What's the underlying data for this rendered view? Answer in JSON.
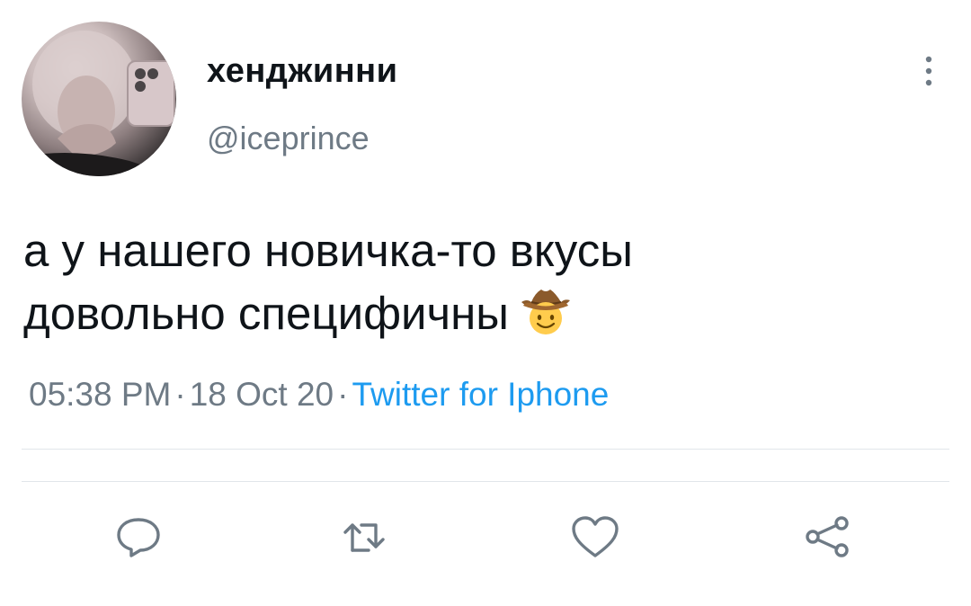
{
  "author": {
    "display_name": "хенджинни",
    "handle": "@iceprince"
  },
  "tweet": {
    "text_line1": "а у нашего новичка-то вкусы",
    "text_line2": "довольно специфичны",
    "emoji": "cowboy-hat-face"
  },
  "meta": {
    "time": "05:38 PM",
    "separator": "·",
    "date": "18 Oct 20",
    "source": "Twitter for Iphone"
  },
  "actions": [
    {
      "name": "reply",
      "icon": "reply-icon"
    },
    {
      "name": "retweet",
      "icon": "retweet-icon"
    },
    {
      "name": "like",
      "icon": "heart-icon"
    },
    {
      "name": "share",
      "icon": "share-icon"
    }
  ],
  "colors": {
    "text": "#0f1419",
    "secondary": "#6e7a85",
    "link": "#1d9bf0",
    "divider": "#e1e6ea",
    "icon": "#6e7a85"
  }
}
